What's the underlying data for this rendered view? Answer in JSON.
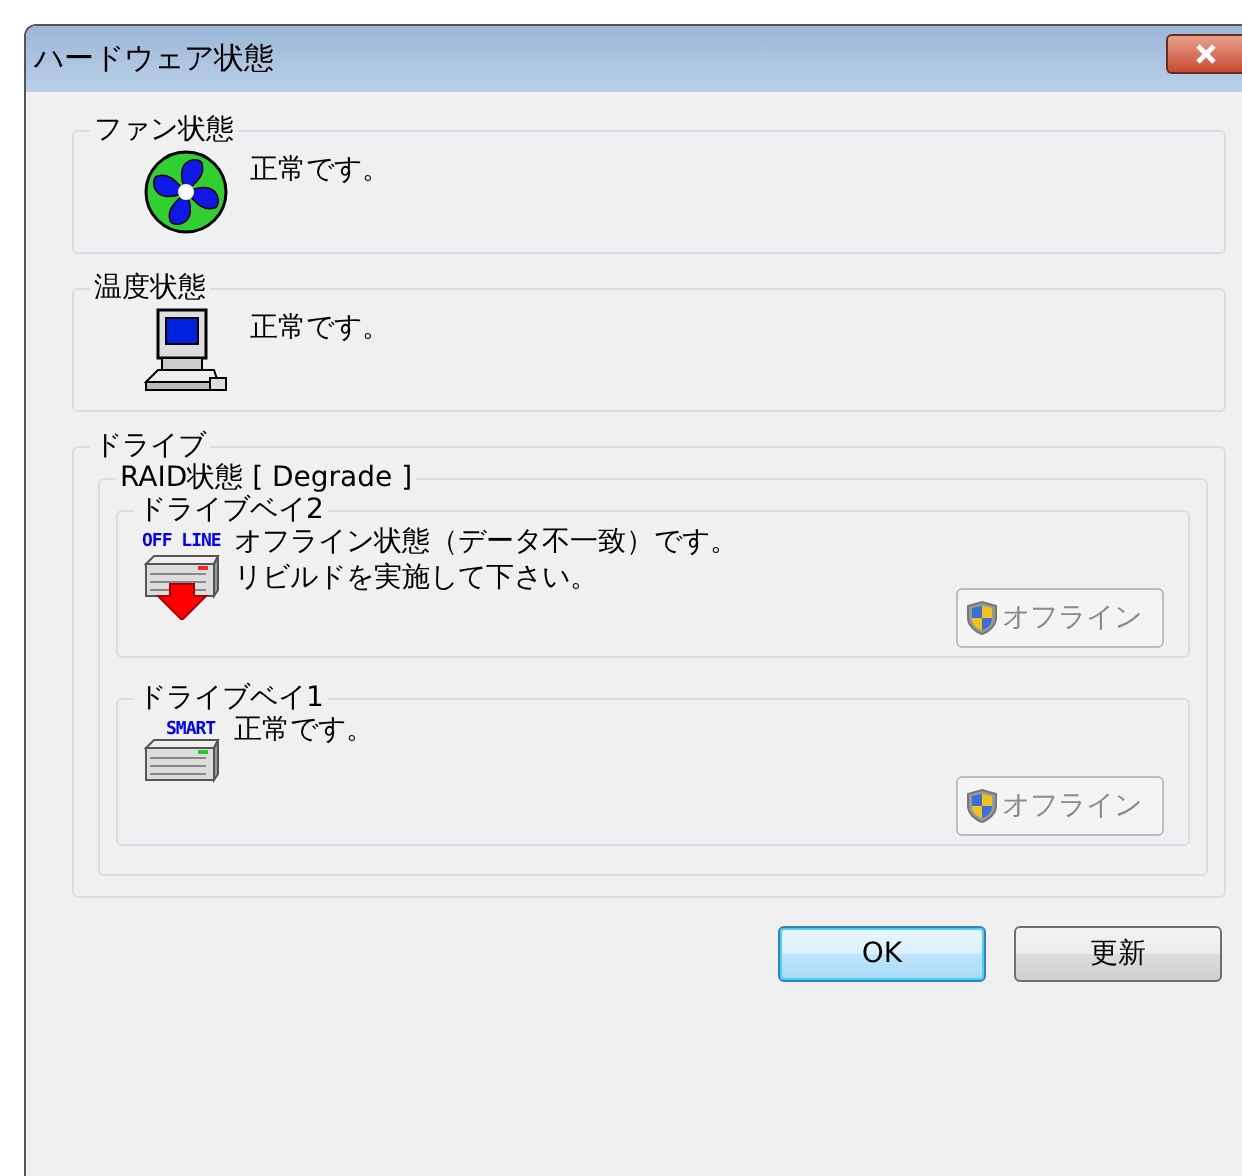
{
  "window": {
    "title": "ハードウェア状態"
  },
  "fan": {
    "label": "ファン状態",
    "status": "正常です。"
  },
  "temperature": {
    "label": "温度状態",
    "status": "正常です。"
  },
  "drive": {
    "label": "ドライブ",
    "raid": {
      "label": "RAID状態 [ Degrade ]",
      "bays": [
        {
          "label": "ドライブベイ2",
          "kind": "offline",
          "icon_text": "OFF LINE",
          "status": [
            "オフライン状態（データ不一致）です。",
            "リビルドを実施して下さい。"
          ],
          "button": {
            "label": "オフライン",
            "disabled": true
          }
        },
        {
          "label": "ドライブベイ1",
          "kind": "smart",
          "icon_text": "SMART",
          "status": [
            "正常です。"
          ],
          "button": {
            "label": "オフライン",
            "disabled": true
          }
        }
      ]
    }
  },
  "buttons": [
    {
      "label": "OK",
      "default": true
    },
    {
      "label": "更新",
      "default": false
    }
  ]
}
